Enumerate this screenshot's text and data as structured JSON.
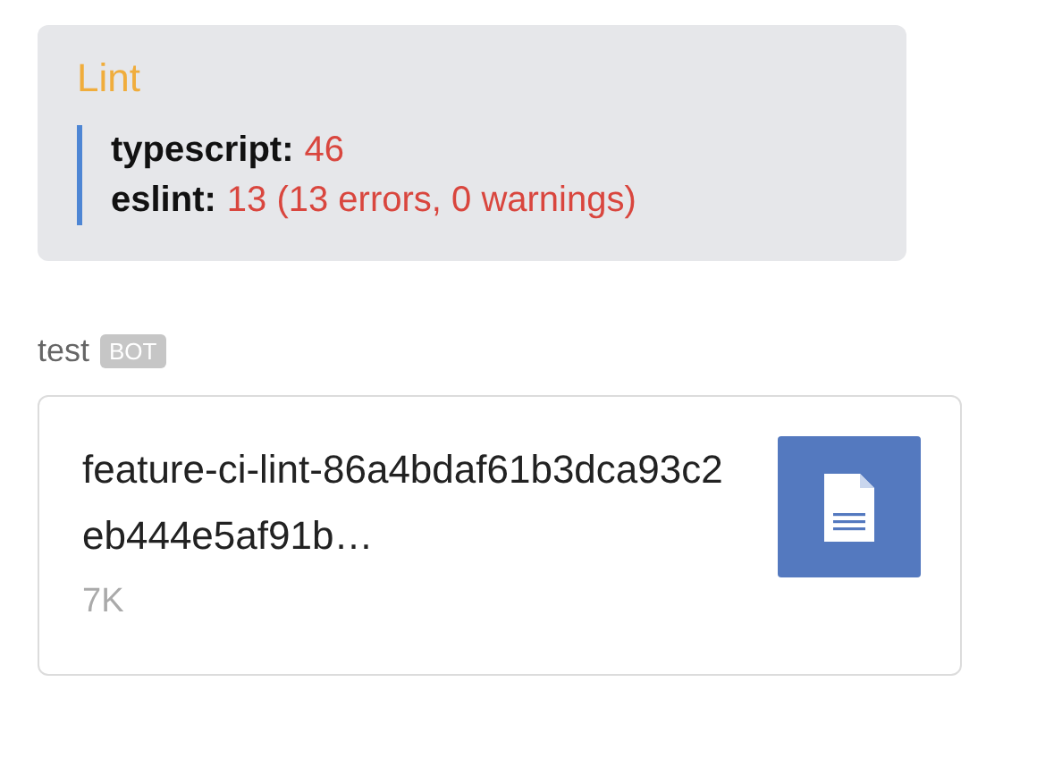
{
  "lint_card": {
    "title": "Lint",
    "results": [
      {
        "label": "typescript:",
        "value": "46"
      },
      {
        "label": "eslint:",
        "value": "13 (13 errors, 0 warnings)"
      }
    ]
  },
  "message": {
    "sender": "test",
    "badge": "BOT",
    "file": {
      "name": "feature-ci-lint-86a4bdaf61b3dca93c2eb444e5af91b…",
      "size": "7K"
    }
  }
}
